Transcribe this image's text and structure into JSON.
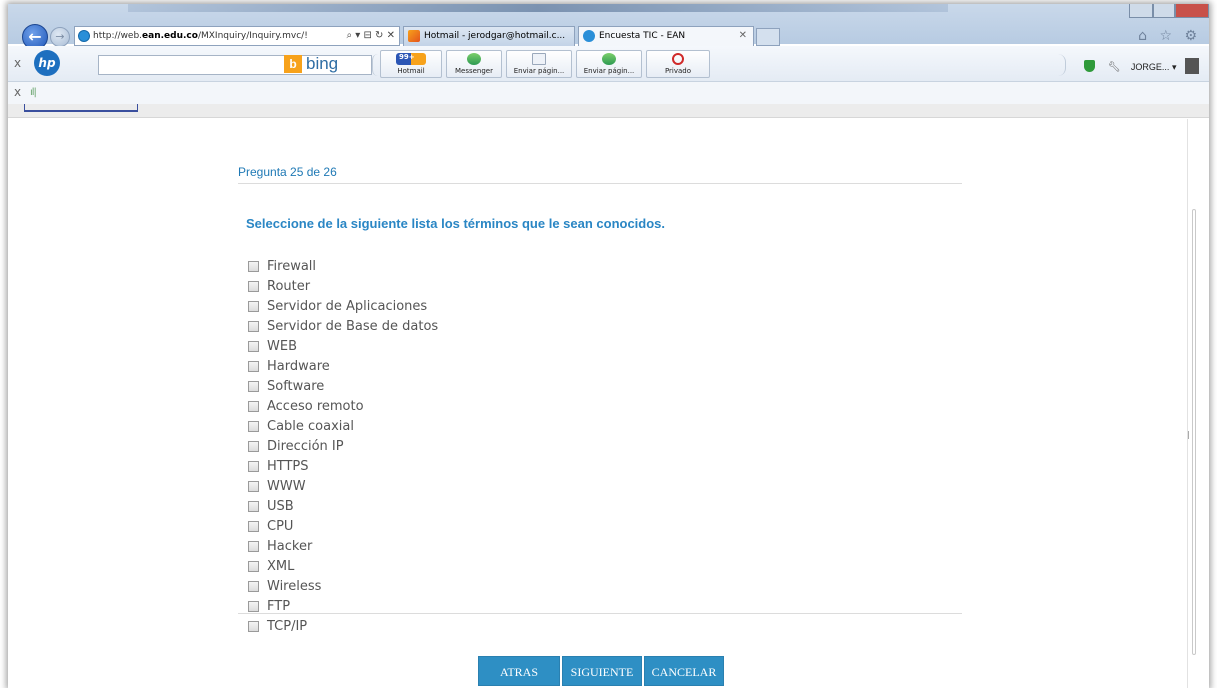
{
  "browser": {
    "address_url": "http://web.",
    "address_url_bold": "ean.edu.co",
    "address_url_rest": "/MXInquiry/Inquiry.mvc/!",
    "address_tools": "⌕ ▾ ⊟ ↻ ✕",
    "tabs": [
      {
        "label": "Hotmail - jerodgar@hotmail.c...",
        "active": false
      },
      {
        "label": "Encuesta TIC - EAN",
        "active": true,
        "close": "✕"
      }
    ],
    "right_icons": "⌂ ☆ ⚙"
  },
  "toolbar": {
    "close_x": "x",
    "search_engine": "bing",
    "buttons": [
      {
        "label": "Hotmail",
        "badge": "99+"
      },
      {
        "label": "Messenger"
      },
      {
        "label": "Enviar págin..."
      },
      {
        "label": "Enviar págin..."
      },
      {
        "label": "Privado"
      }
    ],
    "user": "JORGE...",
    "user_arrow": "▾"
  },
  "toolbar2": {
    "close_x": "x",
    "signal": "ıl|"
  },
  "survey": {
    "progress": "Pregunta 25 de 26",
    "question": "Seleccione de la siguiente lista los términos que le sean conocidos.",
    "options": [
      "Firewall",
      "Router",
      "Servidor de Aplicaciones",
      "Servidor de Base de datos",
      "WEB",
      "Hardware",
      "Software",
      "Acceso remoto",
      "Cable coaxial",
      "Dirección IP",
      "HTTPS",
      "WWW",
      "USB",
      "CPU",
      "Hacker",
      "XML",
      "Wireless",
      "FTP",
      "TCP/IP"
    ],
    "buttons": {
      "back": "ATRAS",
      "next": "SIGUIENTE",
      "cancel": "CANCELAR"
    }
  },
  "colors": {
    "accent": "#2a86c4",
    "button_bg": "#2e8fc4"
  }
}
